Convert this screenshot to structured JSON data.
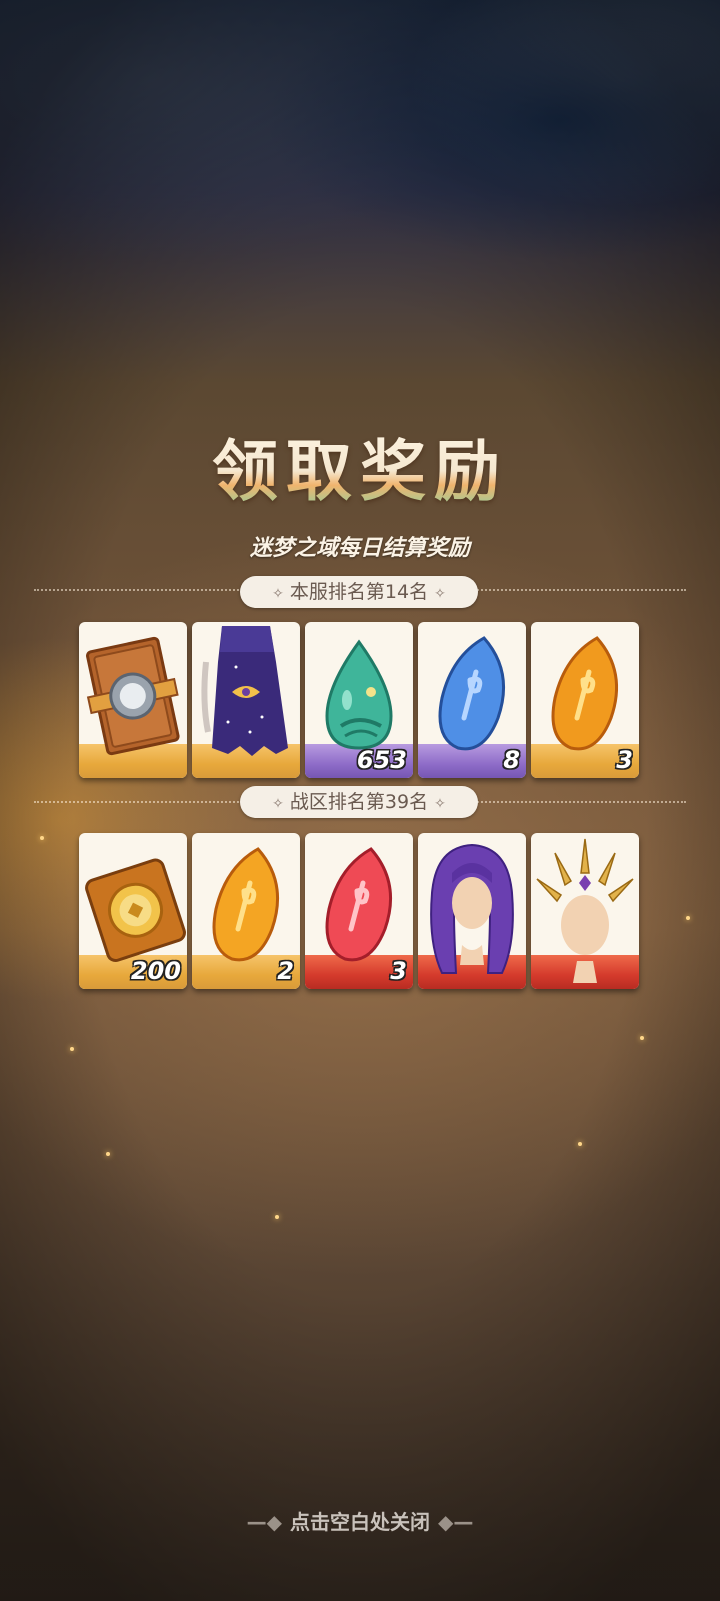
{
  "header": {
    "title": "领取奖励",
    "subtitle": "迷梦之域每日结算奖励"
  },
  "server_rank": {
    "label": "本服排名第14名",
    "rewards": [
      {
        "icon": "card-frame-icon",
        "qty": ""
      },
      {
        "icon": "starry-dress-icon",
        "qty": ""
      },
      {
        "icon": "green-drop-icon",
        "qty": "653"
      },
      {
        "icon": "blue-crystal-icon",
        "qty": "8"
      },
      {
        "icon": "orange-crystal-icon",
        "qty": "3"
      }
    ]
  },
  "zone_rank": {
    "label": "战区排名第39名",
    "rewards": [
      {
        "icon": "gold-ticket-icon",
        "qty": "200"
      },
      {
        "icon": "orange-crystal-icon",
        "qty": "2"
      },
      {
        "icon": "red-crystal-icon",
        "qty": "3"
      },
      {
        "icon": "purple-hair-icon",
        "qty": ""
      },
      {
        "icon": "golden-crown-icon",
        "qty": ""
      }
    ]
  },
  "footer": {
    "close_hint": "点击空白处关闭"
  },
  "colors": {
    "gold_base": "#e7a83b",
    "purple_base": "#8e6cc8",
    "red_base": "#d43a2c",
    "pill_bg": "#f5efe6"
  }
}
